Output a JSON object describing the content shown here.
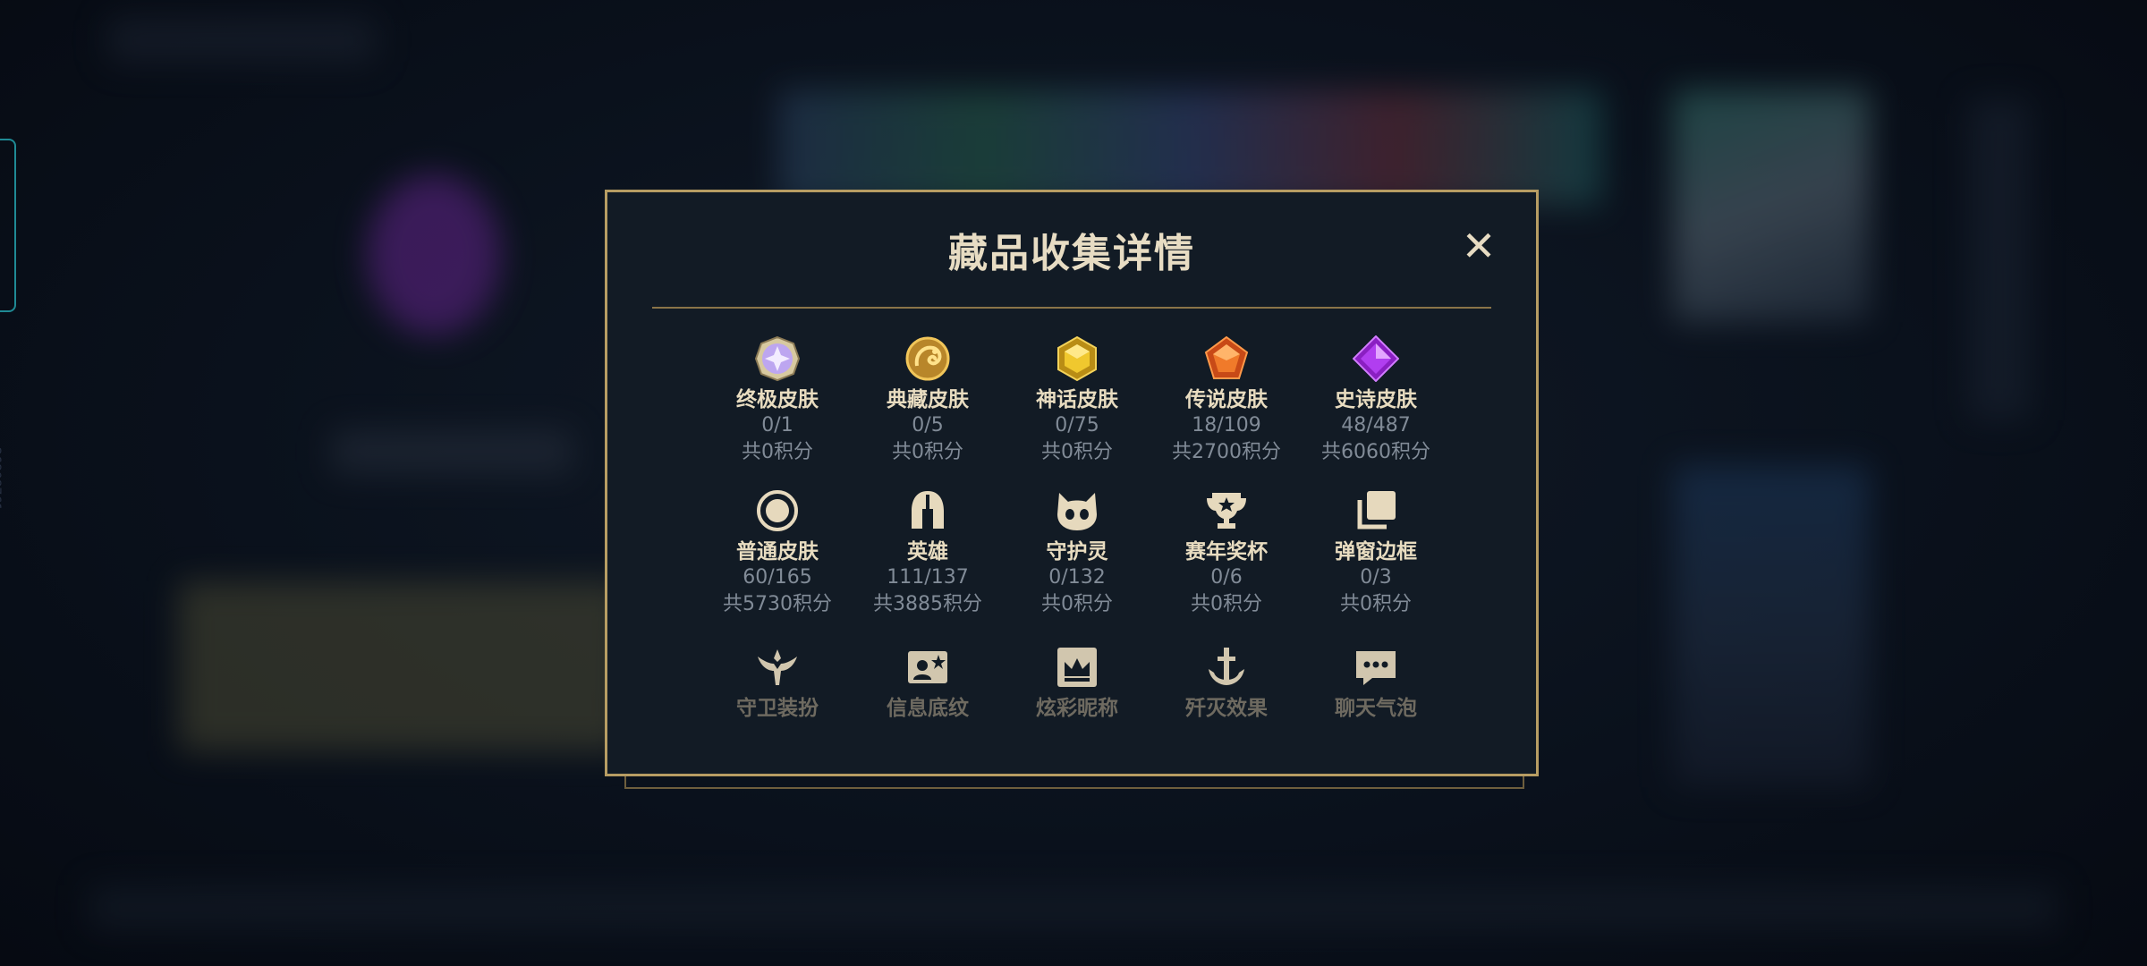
{
  "dialog": {
    "title": "藏品收集详情",
    "close_label": "✕"
  },
  "row1": [
    {
      "name": "终极皮肤",
      "count": "0/1",
      "points": "共0积分",
      "icon": "ultimate-skin-gem-icon"
    },
    {
      "name": "典藏皮肤",
      "count": "0/5",
      "points": "共0积分",
      "icon": "prestige-skin-dragon-icon"
    },
    {
      "name": "神话皮肤",
      "count": "0/75",
      "points": "共0积分",
      "icon": "mythic-skin-gem-icon"
    },
    {
      "name": "传说皮肤",
      "count": "18/109",
      "points": "共2700积分",
      "icon": "legendary-skin-gem-icon"
    },
    {
      "name": "史诗皮肤",
      "count": "48/487",
      "points": "共6060积分",
      "icon": "epic-skin-gem-icon"
    }
  ],
  "row2": [
    {
      "name": "普通皮肤",
      "count": "60/165",
      "points": "共5730积分",
      "icon": "common-skin-ring-icon"
    },
    {
      "name": "英雄",
      "count": "111/137",
      "points": "共3885积分",
      "icon": "helmet-icon"
    },
    {
      "name": "守护灵",
      "count": "0/132",
      "points": "共0积分",
      "icon": "guardian-creature-icon"
    },
    {
      "name": "赛年奖杯",
      "count": "0/6",
      "points": "共0积分",
      "icon": "trophy-icon"
    },
    {
      "name": "弹窗边框",
      "count": "0/3",
      "points": "共0积分",
      "icon": "frame-stack-icon"
    }
  ],
  "row3": [
    {
      "name": "守卫装扮",
      "icon": "ward-skin-icon"
    },
    {
      "name": "信息底纹",
      "icon": "profile-banner-icon"
    },
    {
      "name": "炫彩昵称",
      "icon": "crown-nameplate-icon"
    },
    {
      "name": "歼灭效果",
      "icon": "anchor-effect-icon"
    },
    {
      "name": "聊天气泡",
      "icon": "chat-bubble-icon"
    }
  ],
  "side_id": "26808761",
  "colors": {
    "gold": "#b79d63",
    "panel": "#121b25",
    "text": "#e8dcc0",
    "muted": "#818b97"
  }
}
